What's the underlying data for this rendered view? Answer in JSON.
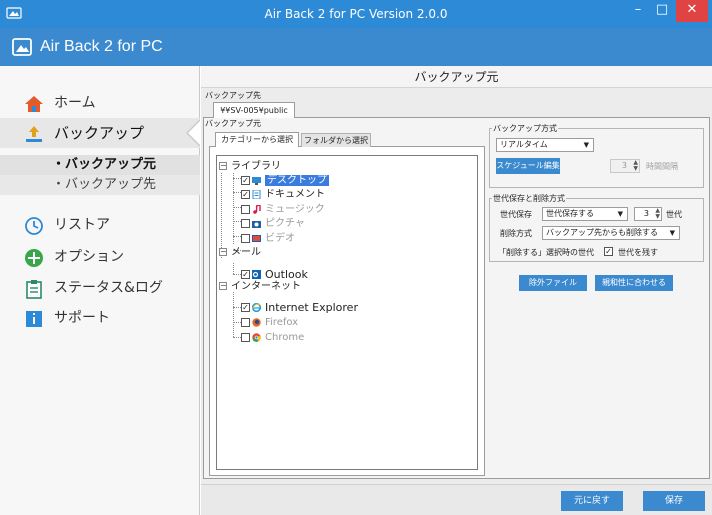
{
  "window": {
    "title": "Air Back 2 for PC Version 2.0.0"
  },
  "header": {
    "app_name": "Air Back 2 for PC"
  },
  "sidebar": {
    "items": [
      {
        "label": "ホーム",
        "icon": "home-icon"
      },
      {
        "label": "バックアップ",
        "icon": "backup-icon"
      },
      {
        "label": "リストア",
        "icon": "restore-icon"
      },
      {
        "label": "オプション",
        "icon": "option-icon"
      },
      {
        "label": "ステータス&ログ",
        "icon": "log-icon"
      },
      {
        "label": "サポート",
        "icon": "support-icon"
      }
    ],
    "sub_items": [
      {
        "label": "・バックアップ元"
      },
      {
        "label": "・バックアップ先"
      }
    ]
  },
  "main": {
    "title": "バックアップ元",
    "dest_label": "バックアップ先",
    "dest_tab": "¥¥SV-005¥public",
    "source_label": "バックアップ元",
    "tabs": [
      {
        "label": "カテゴリーから選択"
      },
      {
        "label": "フォルダから選択"
      }
    ],
    "tree": {
      "library": "ライブラリ",
      "desktop": "デスクトップ",
      "documents": "ドキュメント",
      "music": "ミュージック",
      "pictures": "ピクチャ",
      "video": "ビデオ",
      "mail": "メール",
      "outlook": "Outlook",
      "internet": "インターネット",
      "ie": "Internet Explorer",
      "firefox": "Firefox",
      "chrome": "Chrome"
    },
    "method": {
      "title": "バックアップ方式",
      "selected": "リアルタイム",
      "schedule_button": "スケジュール編集",
      "interval_value": "3",
      "interval_label": "時間間隔"
    },
    "generation": {
      "title": "世代保存と削除方式",
      "save_label": "世代保存",
      "save_selected": "世代保存する",
      "count_value": "3",
      "count_unit": "世代",
      "delete_label": "削除方式",
      "delete_selected": "バックアップ先からも削除する",
      "on_delete_label": "「削除する」選択時の世代",
      "keep_generation_label": "世代を残す"
    },
    "exclude_button": "除外ファイル",
    "affinity_button": "親和性に合わせる"
  },
  "footer": {
    "revert_button": "元に戻す",
    "save_button": "保存"
  },
  "colors": {
    "titlebar": "#2d8ad6",
    "header": "#3b89cf",
    "accent": "#3b89cf",
    "close": "#e04343",
    "selection": "#3a7cde"
  }
}
